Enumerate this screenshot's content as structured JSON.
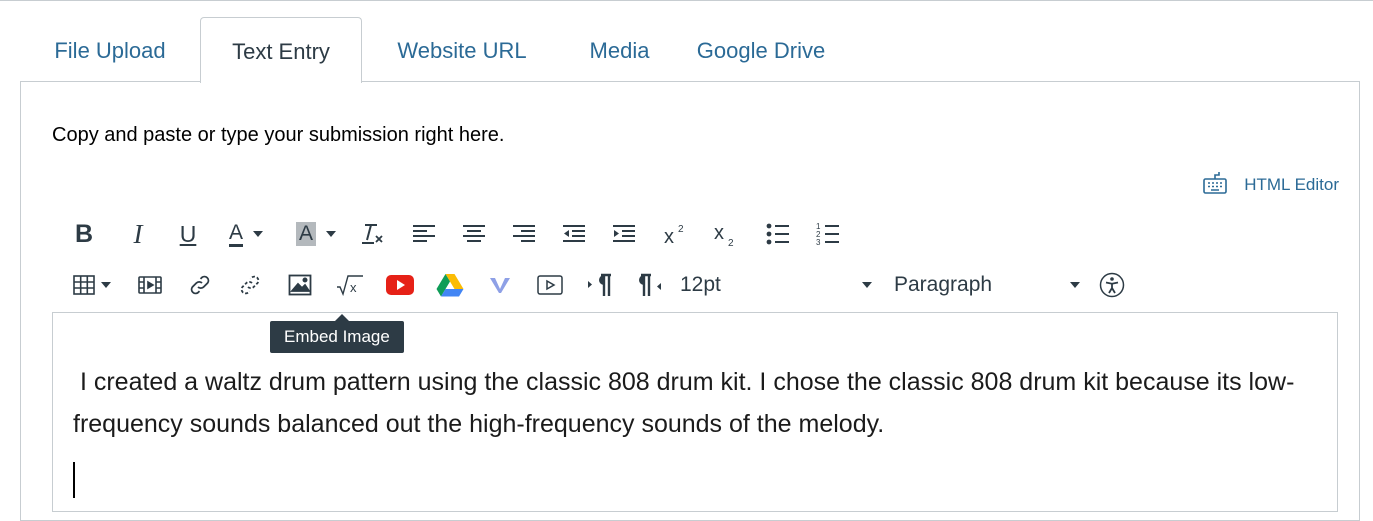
{
  "tabs": [
    {
      "label": "File Upload",
      "active": false
    },
    {
      "label": "Text Entry",
      "active": true
    },
    {
      "label": "Website URL",
      "active": false
    },
    {
      "label": "Media",
      "active": false
    },
    {
      "label": "Google Drive",
      "active": false
    }
  ],
  "instructions": "Copy and paste or type your submission right here.",
  "html_editor": {
    "label": "HTML Editor",
    "icon": "keyboard-icon"
  },
  "toolbar": {
    "bold": "B",
    "italic": "I",
    "underline": "U",
    "font_color": "A",
    "background_color": "A",
    "font_size": "12pt",
    "block_format": "Paragraph"
  },
  "tooltip": "Embed Image",
  "editor": {
    "content": " I created a waltz drum pattern using the classic 808 drum kit. I chose the classic 808 drum kit because its low-frequency sounds balanced out the high-frequency sounds of the melody."
  },
  "colors": {
    "link": "#2b6a96",
    "text": "#2d3b45",
    "border": "#c7cdd1",
    "youtube_red": "#e62117",
    "tooltip_bg": "#2d3b45"
  }
}
